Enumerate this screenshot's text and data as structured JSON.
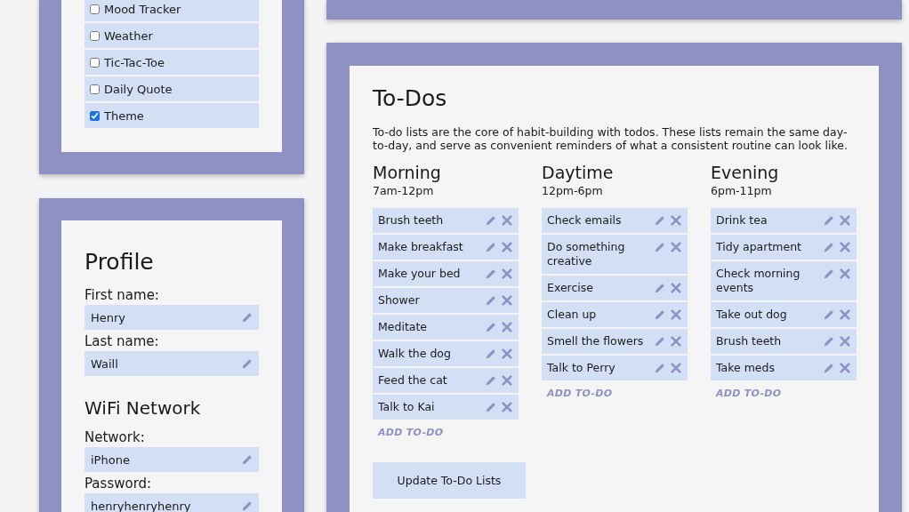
{
  "feature_toggles": [
    {
      "label": "Mood Tracker",
      "checked": false
    },
    {
      "label": "Weather",
      "checked": false
    },
    {
      "label": "Tic-Tac-Toe",
      "checked": false
    },
    {
      "label": "Daily Quote",
      "checked": false
    },
    {
      "label": "Theme",
      "checked": true
    }
  ],
  "profile": {
    "title": "Profile",
    "fields": [
      {
        "label": "First name:",
        "value": "Henry"
      },
      {
        "label": "Last name:",
        "value": "Waill"
      }
    ]
  },
  "wifi": {
    "title": "WiFi Network",
    "fields": [
      {
        "label": "Network:",
        "value": "iPhone"
      },
      {
        "label": "Password:",
        "value": "henryhenryhenry"
      }
    ]
  },
  "todos": {
    "title": "To-Dos",
    "description": "To-do lists are the core of habit-building with todos. These lists remain the same day-to-day, and serve as convenient reminders of what a consistent routine can look like.",
    "lists": [
      {
        "name": "Morning",
        "hours": "7am-12pm",
        "items": [
          "Brush teeth",
          "Make breakfast",
          "Make your bed",
          "Shower",
          "Meditate",
          "Walk the dog",
          "Feed the cat",
          "Talk to Kai"
        ],
        "add_label": "ADD TO-DO"
      },
      {
        "name": "Daytime",
        "hours": "12pm-6pm",
        "items": [
          "Check emails",
          "Do something creative",
          "Exercise",
          "Clean up",
          "Smell the flowers",
          "Talk to Perry"
        ],
        "add_label": "ADD TO-DO"
      },
      {
        "name": "Evening",
        "hours": "6pm-11pm",
        "items": [
          "Drink tea",
          "Tidy apartment",
          "Check morning events",
          "Take out dog",
          "Brush teeth",
          "Take meds"
        ],
        "add_label": "ADD TO-DO"
      }
    ],
    "update_button": "Update To-Do Lists"
  }
}
